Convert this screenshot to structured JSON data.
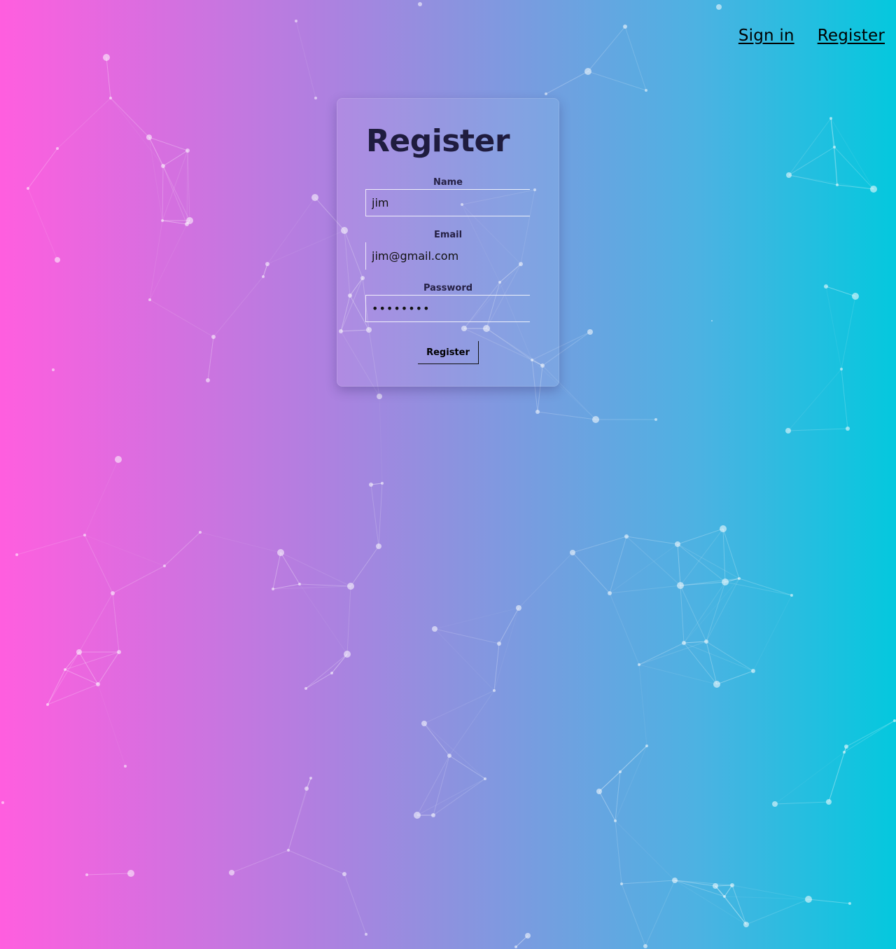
{
  "nav": {
    "sign_in": "Sign in",
    "register": "Register"
  },
  "form": {
    "title": "Register",
    "name_label": "Name",
    "name_value": "jim",
    "email_label": "Email",
    "email_value": "jim@gmail.com",
    "password_label": "Password",
    "password_value": "........",
    "password_display": "●●●●●●●●",
    "submit_label": "Register"
  },
  "colors": {
    "gradient_left": "#ff5edf",
    "gradient_right": "#04c8de",
    "text_dark": "#1f1c3f",
    "particle": "#ffffff"
  }
}
